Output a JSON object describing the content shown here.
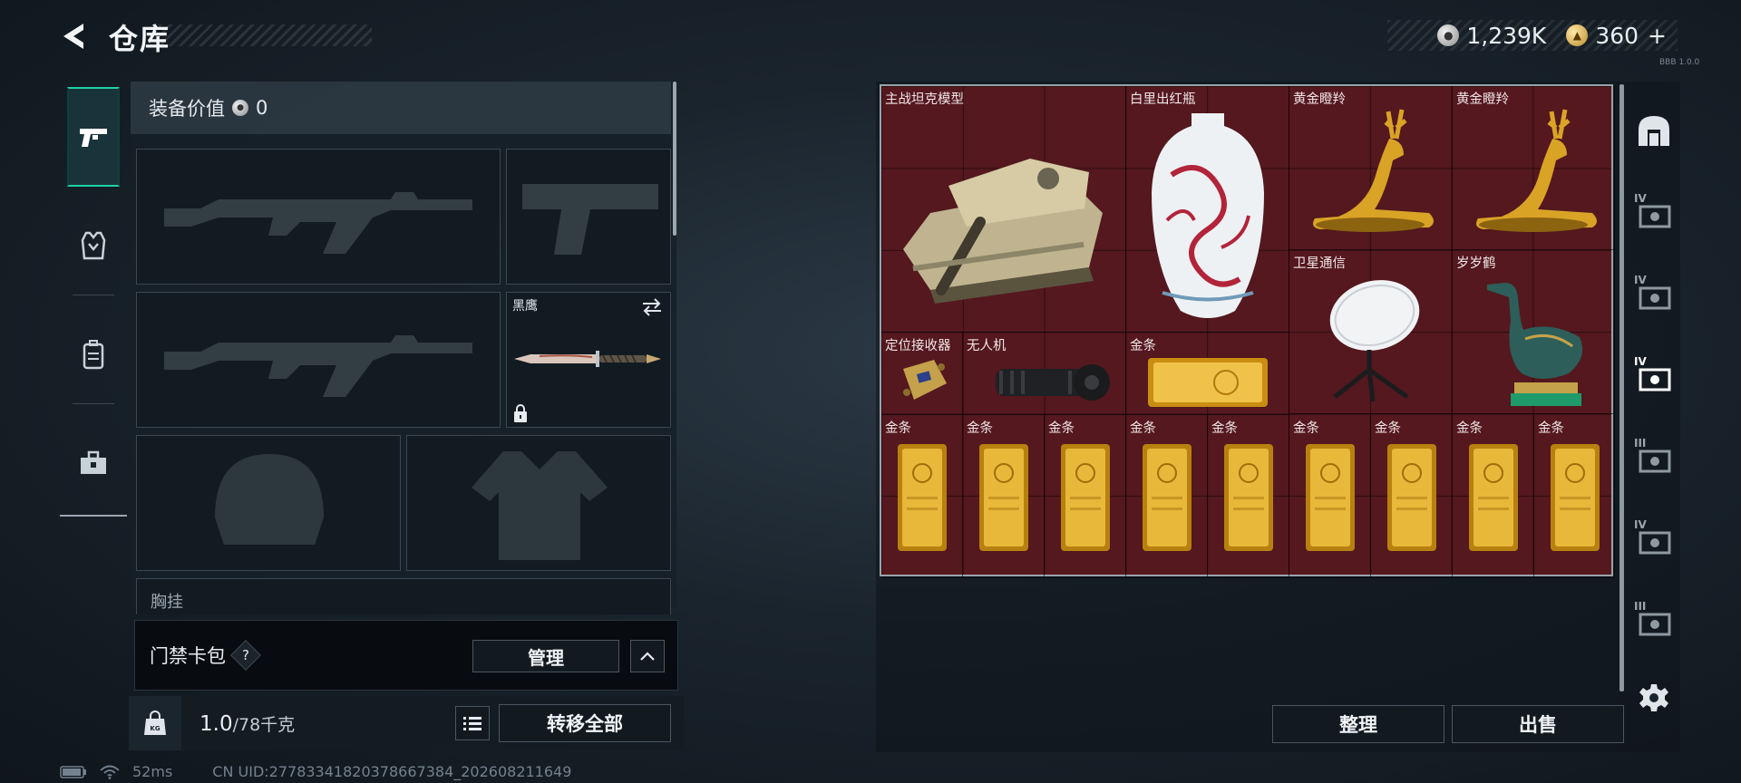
{
  "header": {
    "title": "仓库",
    "silver_amount": "1,239K",
    "gold_amount": "360",
    "gold_add": "+",
    "version": "BBB 1.0.0"
  },
  "left_tabs": [
    {
      "icon": "pistol-icon",
      "active": true
    },
    {
      "icon": "armor-vest-icon",
      "active": false
    },
    {
      "icon": "backpack-icon",
      "active": false
    },
    {
      "icon": "toolbox-icon",
      "active": false
    }
  ],
  "equipment": {
    "value_label": "装备价值",
    "value": "0",
    "melee_label": "黑鹰",
    "chest_label": "胸挂"
  },
  "keycard": {
    "label": "门禁卡包",
    "help": "?",
    "manage_label": "管理"
  },
  "capacity": {
    "bag_code": "KG",
    "current": "1.0",
    "max": "/78千克",
    "transfer_label": "转移全部"
  },
  "status": {
    "ping": "52ms",
    "uid": "CN UID:27783341820378667384_202608211649"
  },
  "storage": {
    "items": [
      {
        "name": "主战坦克模型",
        "type": "tank"
      },
      {
        "name": "白里出红瓶",
        "type": "vase"
      },
      {
        "name": "黄金瞪羚",
        "type": "gazelle"
      },
      {
        "name": "黄金瞪羚",
        "type": "gazelle"
      },
      {
        "name": "卫星通信",
        "type": "dish"
      },
      {
        "name": "岁岁鹤",
        "type": "crane"
      },
      {
        "name": "定位接收器",
        "type": "receiver"
      },
      {
        "name": "无人机",
        "type": "drone"
      },
      {
        "name": "金条",
        "type": "gold-bar-flat"
      },
      {
        "name": "金条",
        "type": "gold-bar"
      },
      {
        "name": "金条",
        "type": "gold-bar"
      },
      {
        "name": "金条",
        "type": "gold-bar"
      },
      {
        "name": "金条",
        "type": "gold-bar"
      },
      {
        "name": "金条",
        "type": "gold-bar"
      },
      {
        "name": "金条",
        "type": "gold-bar"
      },
      {
        "name": "金条",
        "type": "gold-bar"
      },
      {
        "name": "金条",
        "type": "gold-bar"
      },
      {
        "name": "金条",
        "type": "gold-bar"
      }
    ],
    "sort_label": "整理",
    "sell_label": "出售"
  },
  "right_tabs": [
    {
      "icon": "all-items-icon",
      "level": ""
    },
    {
      "icon": "stash-case-icon",
      "level": "IV"
    },
    {
      "icon": "stash-case-icon",
      "level": "IV"
    },
    {
      "icon": "stash-case-icon",
      "level": "IV"
    },
    {
      "icon": "stash-case-icon",
      "level": "III"
    },
    {
      "icon": "stash-case-icon",
      "level": "IV"
    },
    {
      "icon": "stash-case-icon",
      "level": "III"
    },
    {
      "icon": "gear-icon",
      "level": ""
    }
  ],
  "colors": {
    "accent": "#1fd1a6",
    "grid_bg": "#54181e",
    "gold": "#d9a326"
  }
}
